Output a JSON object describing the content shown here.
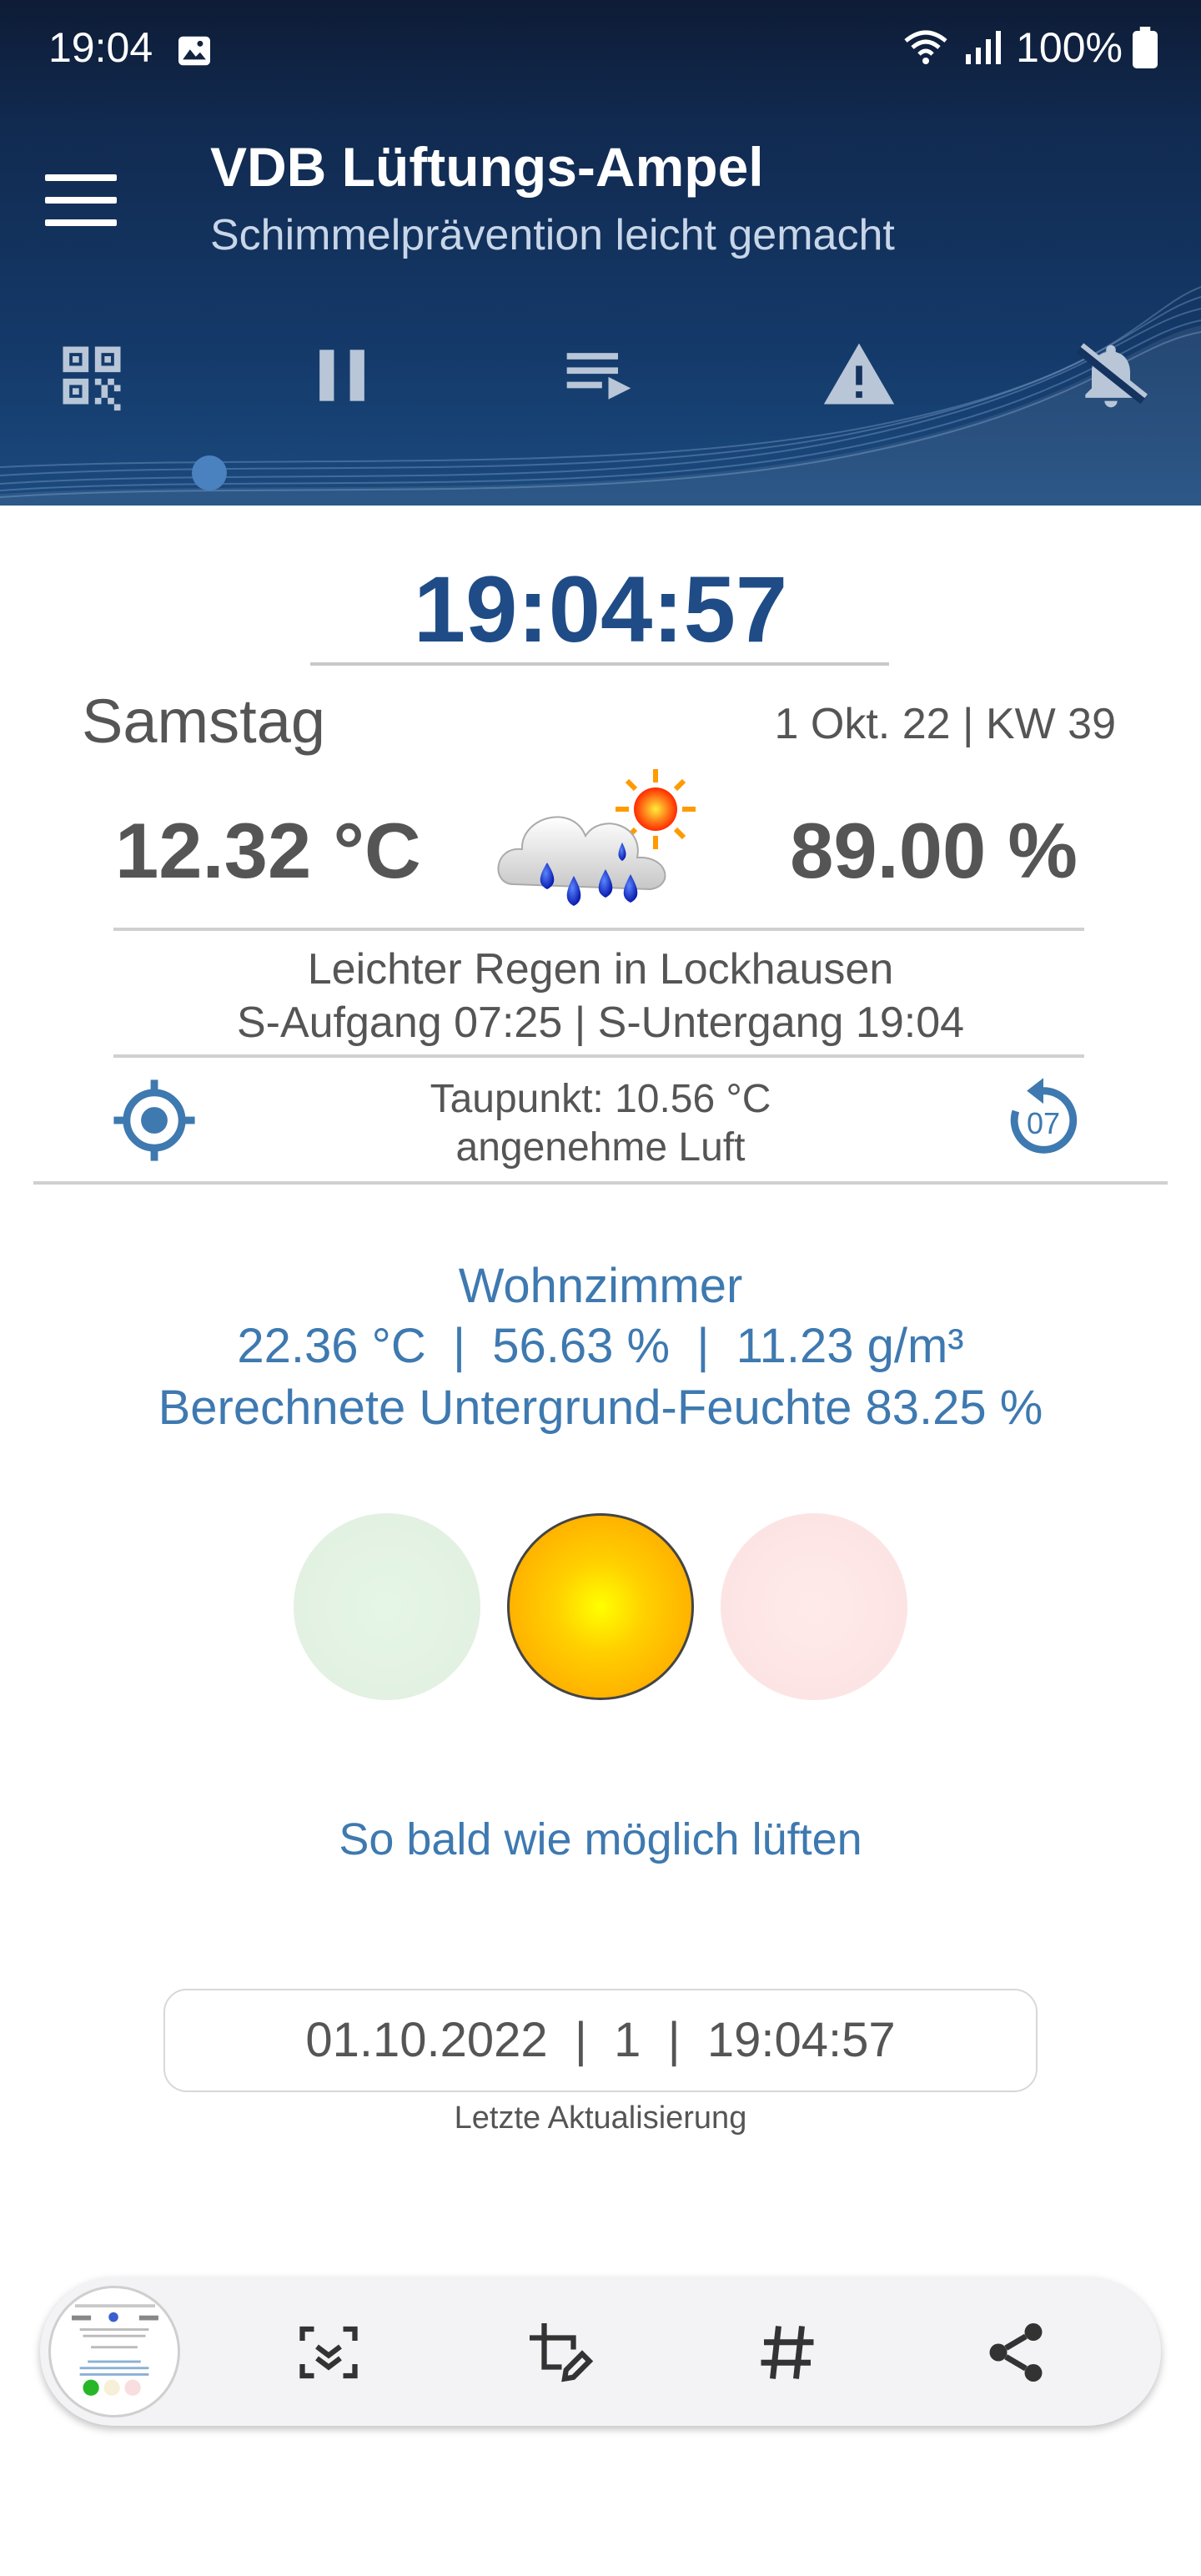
{
  "status_bar": {
    "time": "19:04",
    "battery": "100%"
  },
  "header": {
    "title": "VDB Lüftungs-Ampel",
    "subtitle": "Schimmelprävention leicht gemacht",
    "tools": [
      "qr-code-icon",
      "pause-icon",
      "playlist-icon",
      "warning-icon",
      "notifications-off-icon"
    ]
  },
  "main": {
    "clock": "19:04:57",
    "weekday": "Samstag",
    "date_info": "1 Okt. 22 | KW 39",
    "outdoor_temp": "12.32 °C",
    "outdoor_humidity": "89.00 %",
    "weather_desc": "Leichter Regen in Lockhausen",
    "sun_times": "S-Aufgang 07:25 | S-Untergang 19:04",
    "dewpoint": "Taupunkt: 10.56 °C",
    "air_quality": "angenehme Luft",
    "refresh_count": "07"
  },
  "room": {
    "name": "Wohnzimmer",
    "values": "22.36 °C  |  56.63 %  |  11.23 g/m³",
    "calc": "Berechnete Untergrund-Feuchte 83.25 %"
  },
  "traffic_light": {
    "active": "yellow"
  },
  "advice": "So bald wie möglich lüften",
  "last_update": {
    "value": "01.10.2022  |  1  |  19:04:57",
    "label": "Letzte Aktualisierung"
  },
  "bottom_toolbar": {
    "buttons": [
      "scan-text-icon",
      "edit-crop-icon",
      "hashtag-icon",
      "share-icon"
    ]
  },
  "colors": {
    "accent": "#1f4c86",
    "link_blue": "#3e79b0",
    "header_bg": "#143a6a"
  }
}
